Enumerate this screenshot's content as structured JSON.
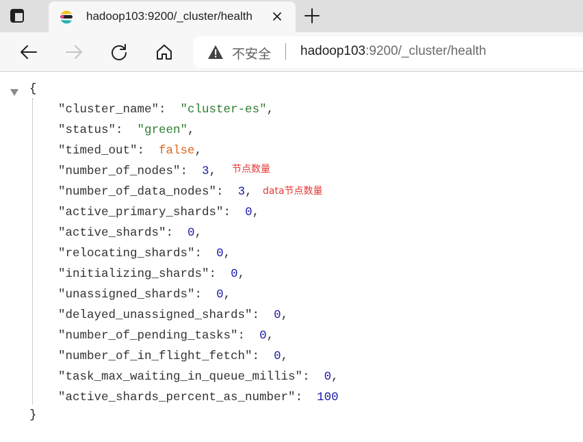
{
  "tab": {
    "title": "hadoop103:9200/_cluster/health"
  },
  "address_bar": {
    "security_label": "不安全",
    "url_host": "hadoop103",
    "url_rest": ":9200/_cluster/health"
  },
  "json": {
    "open_brace": "{",
    "close_brace": "}",
    "entries": [
      {
        "key": "\"cluster_name\"",
        "value": "\"cluster-es\"",
        "type": "string",
        "comma": ","
      },
      {
        "key": "\"status\"",
        "value": "\"green\"",
        "type": "string",
        "comma": ","
      },
      {
        "key": "\"timed_out\"",
        "value": "false",
        "type": "boolean",
        "comma": ","
      },
      {
        "key": "\"number_of_nodes\"",
        "value": "3",
        "type": "number",
        "comma": ","
      },
      {
        "key": "\"number_of_data_nodes\"",
        "value": "3",
        "type": "number",
        "comma": ","
      },
      {
        "key": "\"active_primary_shards\"",
        "value": "0",
        "type": "number",
        "comma": ","
      },
      {
        "key": "\"active_shards\"",
        "value": "0",
        "type": "number",
        "comma": ","
      },
      {
        "key": "\"relocating_shards\"",
        "value": "0",
        "type": "number",
        "comma": ","
      },
      {
        "key": "\"initializing_shards\"",
        "value": "0",
        "type": "number",
        "comma": ","
      },
      {
        "key": "\"unassigned_shards\"",
        "value": "0",
        "type": "number",
        "comma": ","
      },
      {
        "key": "\"delayed_unassigned_shards\"",
        "value": "0",
        "type": "number",
        "comma": ","
      },
      {
        "key": "\"number_of_pending_tasks\"",
        "value": "0",
        "type": "number",
        "comma": ","
      },
      {
        "key": "\"number_of_in_flight_fetch\"",
        "value": "0",
        "type": "number",
        "comma": ","
      },
      {
        "key": "\"task_max_waiting_in_queue_millis\"",
        "value": "0",
        "type": "number",
        "comma": ","
      },
      {
        "key": "\"active_shards_percent_as_number\"",
        "value": "100",
        "type": "number",
        "comma": ""
      }
    ]
  },
  "annotations": {
    "nodes_note": "节点数量",
    "data_nodes_note": "data节点数量"
  },
  "colors": {
    "string": "#2e7d32",
    "boolean": "#e0661a",
    "number": "#1a1aa8",
    "annotation": "#e53935"
  },
  "icons": {
    "tab_actions": "tab-actions-icon",
    "favicon": "elastic-favicon-icon",
    "tab_close": "close-icon",
    "new_tab": "plus-icon",
    "back": "back-arrow-icon",
    "forward": "forward-arrow-icon",
    "refresh": "refresh-icon",
    "home": "home-icon",
    "warning": "warning-icon",
    "collapse": "collapse-triangle-icon"
  }
}
